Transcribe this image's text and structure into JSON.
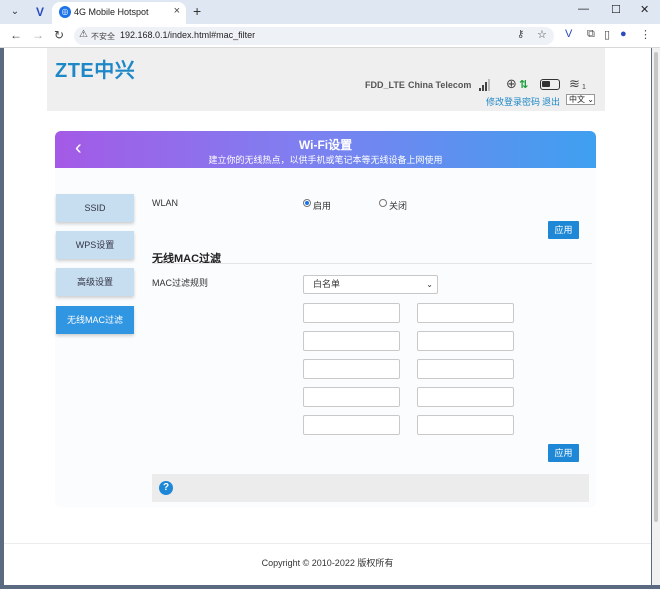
{
  "browser": {
    "tab_title": "4G Mobile Hotspot",
    "insecure_label": "不安全",
    "url": "192.168.0.1/index.html#mac_filter"
  },
  "header": {
    "logo": "ZTE中兴",
    "network_type": "FDD_LTE",
    "operator": "China Telecom",
    "wifi_clients": "1",
    "change_password": "修改登录密码",
    "logout": "退出",
    "language": "中文"
  },
  "banner": {
    "title": "Wi-Fi设置",
    "subtitle": "建立你的无线热点，以供手机或笔记本等无线设备上网使用"
  },
  "sidebar": {
    "items": [
      {
        "label": "SSID"
      },
      {
        "label": "WPS设置"
      },
      {
        "label": "高级设置"
      },
      {
        "label": "无线MAC过滤"
      }
    ]
  },
  "wlan": {
    "label": "WLAN",
    "enable": "启用",
    "disable": "关闭",
    "selected": "启用"
  },
  "apply_label": "应用",
  "mac_filter": {
    "section_title": "无线MAC过滤",
    "rule_label": "MAC过滤规则",
    "rule_value": "白名单",
    "entries": [
      "",
      "",
      "",
      "",
      "",
      "",
      "",
      "",
      "",
      ""
    ]
  },
  "footer": {
    "copyright": "Copyright © 2010-2022 版权所有"
  },
  "colors": {
    "accent": "#1e88d6",
    "active_tab": "#3196e2",
    "inactive_tab": "#c6def0",
    "banner_start": "#a45ae6",
    "banner_end": "#3fa0f0"
  }
}
